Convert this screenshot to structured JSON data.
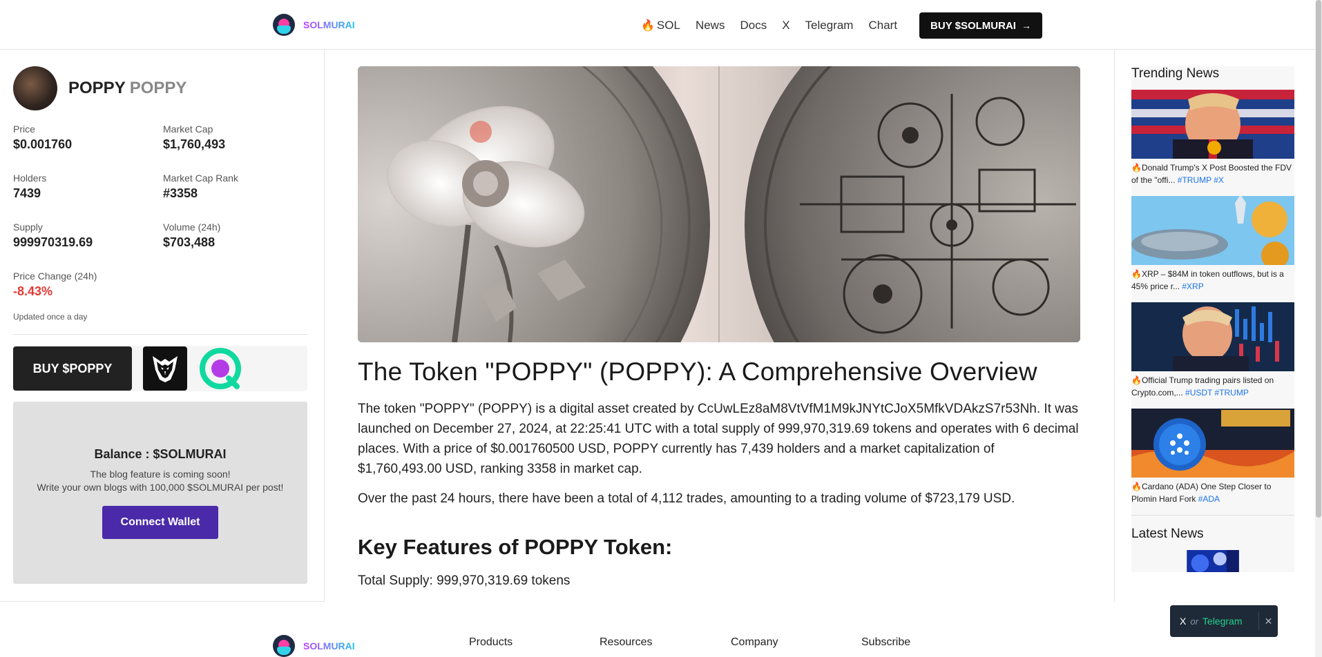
{
  "header": {
    "brand": "SOLMURAI",
    "nav": [
      {
        "label": "SOL",
        "icon": "flame-icon"
      },
      {
        "label": "News"
      },
      {
        "label": "Docs"
      },
      {
        "label": "X"
      },
      {
        "label": "Telegram"
      },
      {
        "label": "Chart"
      }
    ],
    "buy_label": "BUY $SOLMURAI",
    "buy_icon": "arrow-right-icon"
  },
  "token": {
    "name": "POPPY",
    "symbol": "POPPY",
    "stats": {
      "price": {
        "label": "Price",
        "value": "$0.001760"
      },
      "market_cap": {
        "label": "Market Cap",
        "value": "$1,760,493"
      },
      "holders": {
        "label": "Holders",
        "value": "7439"
      },
      "rank": {
        "label": "Market Cap Rank",
        "value": "#3358"
      },
      "supply": {
        "label": "Supply",
        "value": "999970319.69"
      },
      "volume": {
        "label": "Volume (24h)",
        "value": "$703,488"
      },
      "change": {
        "label": "Price Change (24h)",
        "value": "-8.43%"
      }
    },
    "updated": "Updated once a day",
    "buy_label": "BUY $POPPY"
  },
  "balance": {
    "title": "Balance : $SOLMURAI",
    "line1": "The blog feature is coming soon!",
    "line2": "Write your own blogs with 100,000 $SOLMURAI per post!",
    "connect_label": "Connect Wallet"
  },
  "article": {
    "title": "The Token \"POPPY\" (POPPY): A Comprehensive Overview",
    "para1": "The token \"POPPY\" (POPPY) is a digital asset created by CcUwLEz8aM8VtVfM1M9kJNYtCJoX5MfkVDAkzS7r53Nh. It was launched on December 27, 2024, at 22:25:41 UTC with a total supply of 999,970,319.69 tokens and operates with 6 decimal places. With a price of $0.001760500 USD, POPPY currently has 7,439 holders and a market capitalization of $1,760,493.00 USD, ranking 3358 in market cap.",
    "para2": "Over the past 24 hours, there have been a total of 4,112 trades, amounting to a trading volume of $723,179 USD.",
    "h2": "Key Features of POPPY Token:",
    "feature1": "Total Supply: 999,970,319.69 tokens"
  },
  "sidebar_right": {
    "trending_title": "Trending News",
    "trending": [
      {
        "fire": "🔥",
        "text": "Donald Trump's X Post Boosted the FDV of the \"offi...",
        "tags": "#TRUMP #X"
      },
      {
        "fire": "🔥",
        "text": "XRP – $84M in token outflows, but is a 45% price r...",
        "tags": "#XRP"
      },
      {
        "fire": "🔥",
        "text": "Official Trump trading pairs listed on Crypto.com,...",
        "tags": "#USDT #TRUMP"
      },
      {
        "fire": "🔥",
        "text": "Cardano (ADA) One Step Closer to Plomin Hard Fork",
        "tags": "#ADA"
      }
    ],
    "latest_title": "Latest News"
  },
  "footer": {
    "brand": "SOLMURAI",
    "cols": [
      "Products",
      "Resources",
      "Company",
      "Subscribe"
    ]
  },
  "toast": {
    "x": "X",
    "or": "or",
    "telegram": "Telegram",
    "close": "✕"
  },
  "colors": {
    "accent_purple": "#4a2aa8",
    "negative": "#e53935",
    "link": "#1a73e8",
    "toast_bg": "#1f2a38",
    "telegram_green": "#22d38a"
  }
}
